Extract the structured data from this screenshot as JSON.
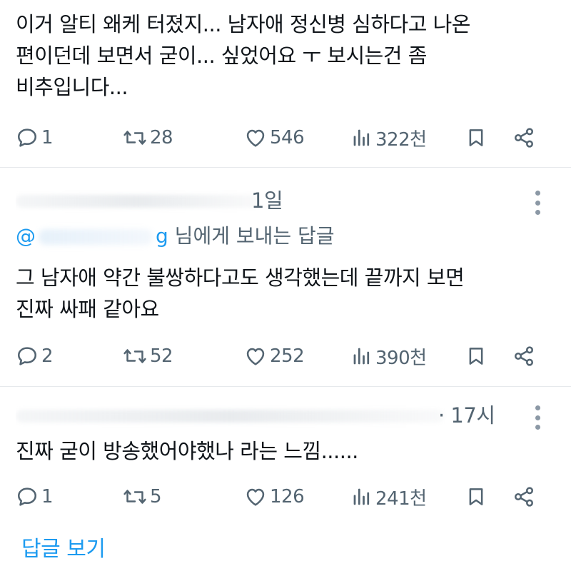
{
  "tweets": [
    {
      "text_lines": [
        "이거 알티 왜케 터졌지... 남자애 정신병 심하다고 나온",
        "편이던데 보면서 굳이... 싶었어요 ㅜ 보시는건 좀",
        "비추입니다..."
      ],
      "replies": "1",
      "retweets": "28",
      "likes": "546",
      "views": "322천"
    },
    {
      "meta_tail": "1일",
      "reply_prefix": "@",
      "reply_handle_end": "g",
      "reply_suffix": " 님에게 보내는 답글",
      "text_lines": [
        "그 남자애 약간 불쌍하다고도 생각했는데 끝까지 보면",
        "진짜 싸패 같아요"
      ],
      "replies": "2",
      "retweets": "52",
      "likes": "252",
      "views": "390천"
    },
    {
      "meta_tail": "· 17시",
      "text_lines": [
        "진짜 굳이 방송했어야했나 라는 느낌......"
      ],
      "replies": "1",
      "retweets": "5",
      "likes": "126",
      "views": "241천"
    }
  ],
  "show_replies_label": "답글 보기",
  "icons": {
    "reply": "reply-icon",
    "retweet": "retweet-icon",
    "like": "heart-icon",
    "views": "views-icon",
    "bookmark": "bookmark-icon",
    "share": "share-icon",
    "more": "more-icon"
  },
  "colors": {
    "text": "#0f1419",
    "muted": "#536471",
    "accent": "#1d9bf0",
    "divider": "#e6e9ec"
  }
}
